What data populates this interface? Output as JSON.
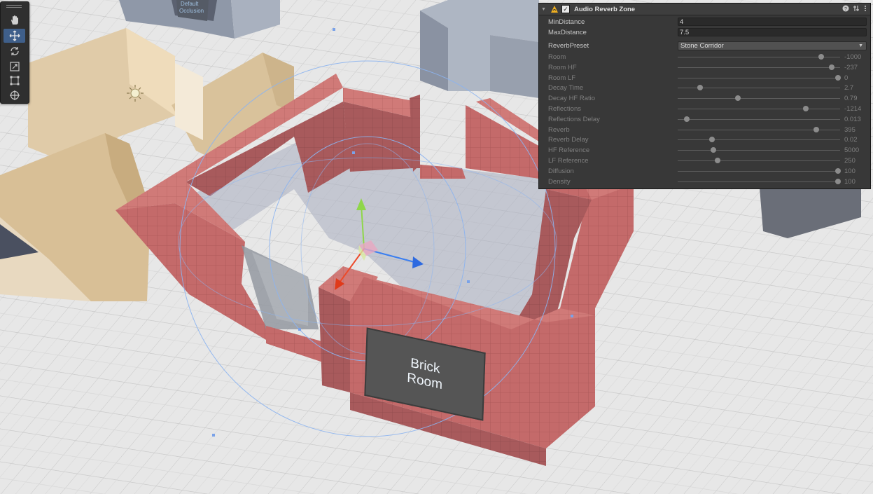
{
  "scene": {
    "sign_text_line1": "Brick",
    "sign_text_line2": "Room",
    "far_sign_line1": "Default",
    "far_sign_line2": "Occlusion"
  },
  "toolbar": {
    "tools": [
      {
        "name": "hand-tool",
        "active": false
      },
      {
        "name": "move-tool",
        "active": true
      },
      {
        "name": "rotate-tool",
        "active": false
      },
      {
        "name": "scale-tool",
        "active": false
      },
      {
        "name": "rect-tool",
        "active": false
      },
      {
        "name": "transform-tool",
        "active": false
      }
    ]
  },
  "component": {
    "title": "Audio Reverb Zone",
    "enabled": true,
    "min_distance": {
      "label": "MinDistance",
      "value": "4"
    },
    "max_distance": {
      "label": "MaxDistance",
      "value": "7.5"
    },
    "preset": {
      "label": "ReverbPreset",
      "value": "Stone Corridor"
    },
    "sliders": [
      {
        "label": "Room",
        "value": "-1000",
        "fraction": 0.885
      },
      {
        "label": "Room HF",
        "value": "-237",
        "fraction": 0.95
      },
      {
        "label": "Room LF",
        "value": "0",
        "fraction": 0.987
      },
      {
        "label": "Decay Time",
        "value": "2.7",
        "fraction": 0.14
      },
      {
        "label": "Decay HF Ratio",
        "value": "0.79",
        "fraction": 0.37
      },
      {
        "label": "Reflections",
        "value": "-1214",
        "fraction": 0.79
      },
      {
        "label": "Reflections Delay",
        "value": "0.013",
        "fraction": 0.055
      },
      {
        "label": "Reverb",
        "value": "395",
        "fraction": 0.855
      },
      {
        "label": "Reverb Delay",
        "value": "0.02",
        "fraction": 0.21
      },
      {
        "label": "HF Reference",
        "value": "5000",
        "fraction": 0.22
      },
      {
        "label": "LF Reference",
        "value": "250",
        "fraction": 0.245
      },
      {
        "label": "Diffusion",
        "value": "100",
        "fraction": 0.987
      },
      {
        "label": "Density",
        "value": "100",
        "fraction": 0.987
      }
    ]
  }
}
